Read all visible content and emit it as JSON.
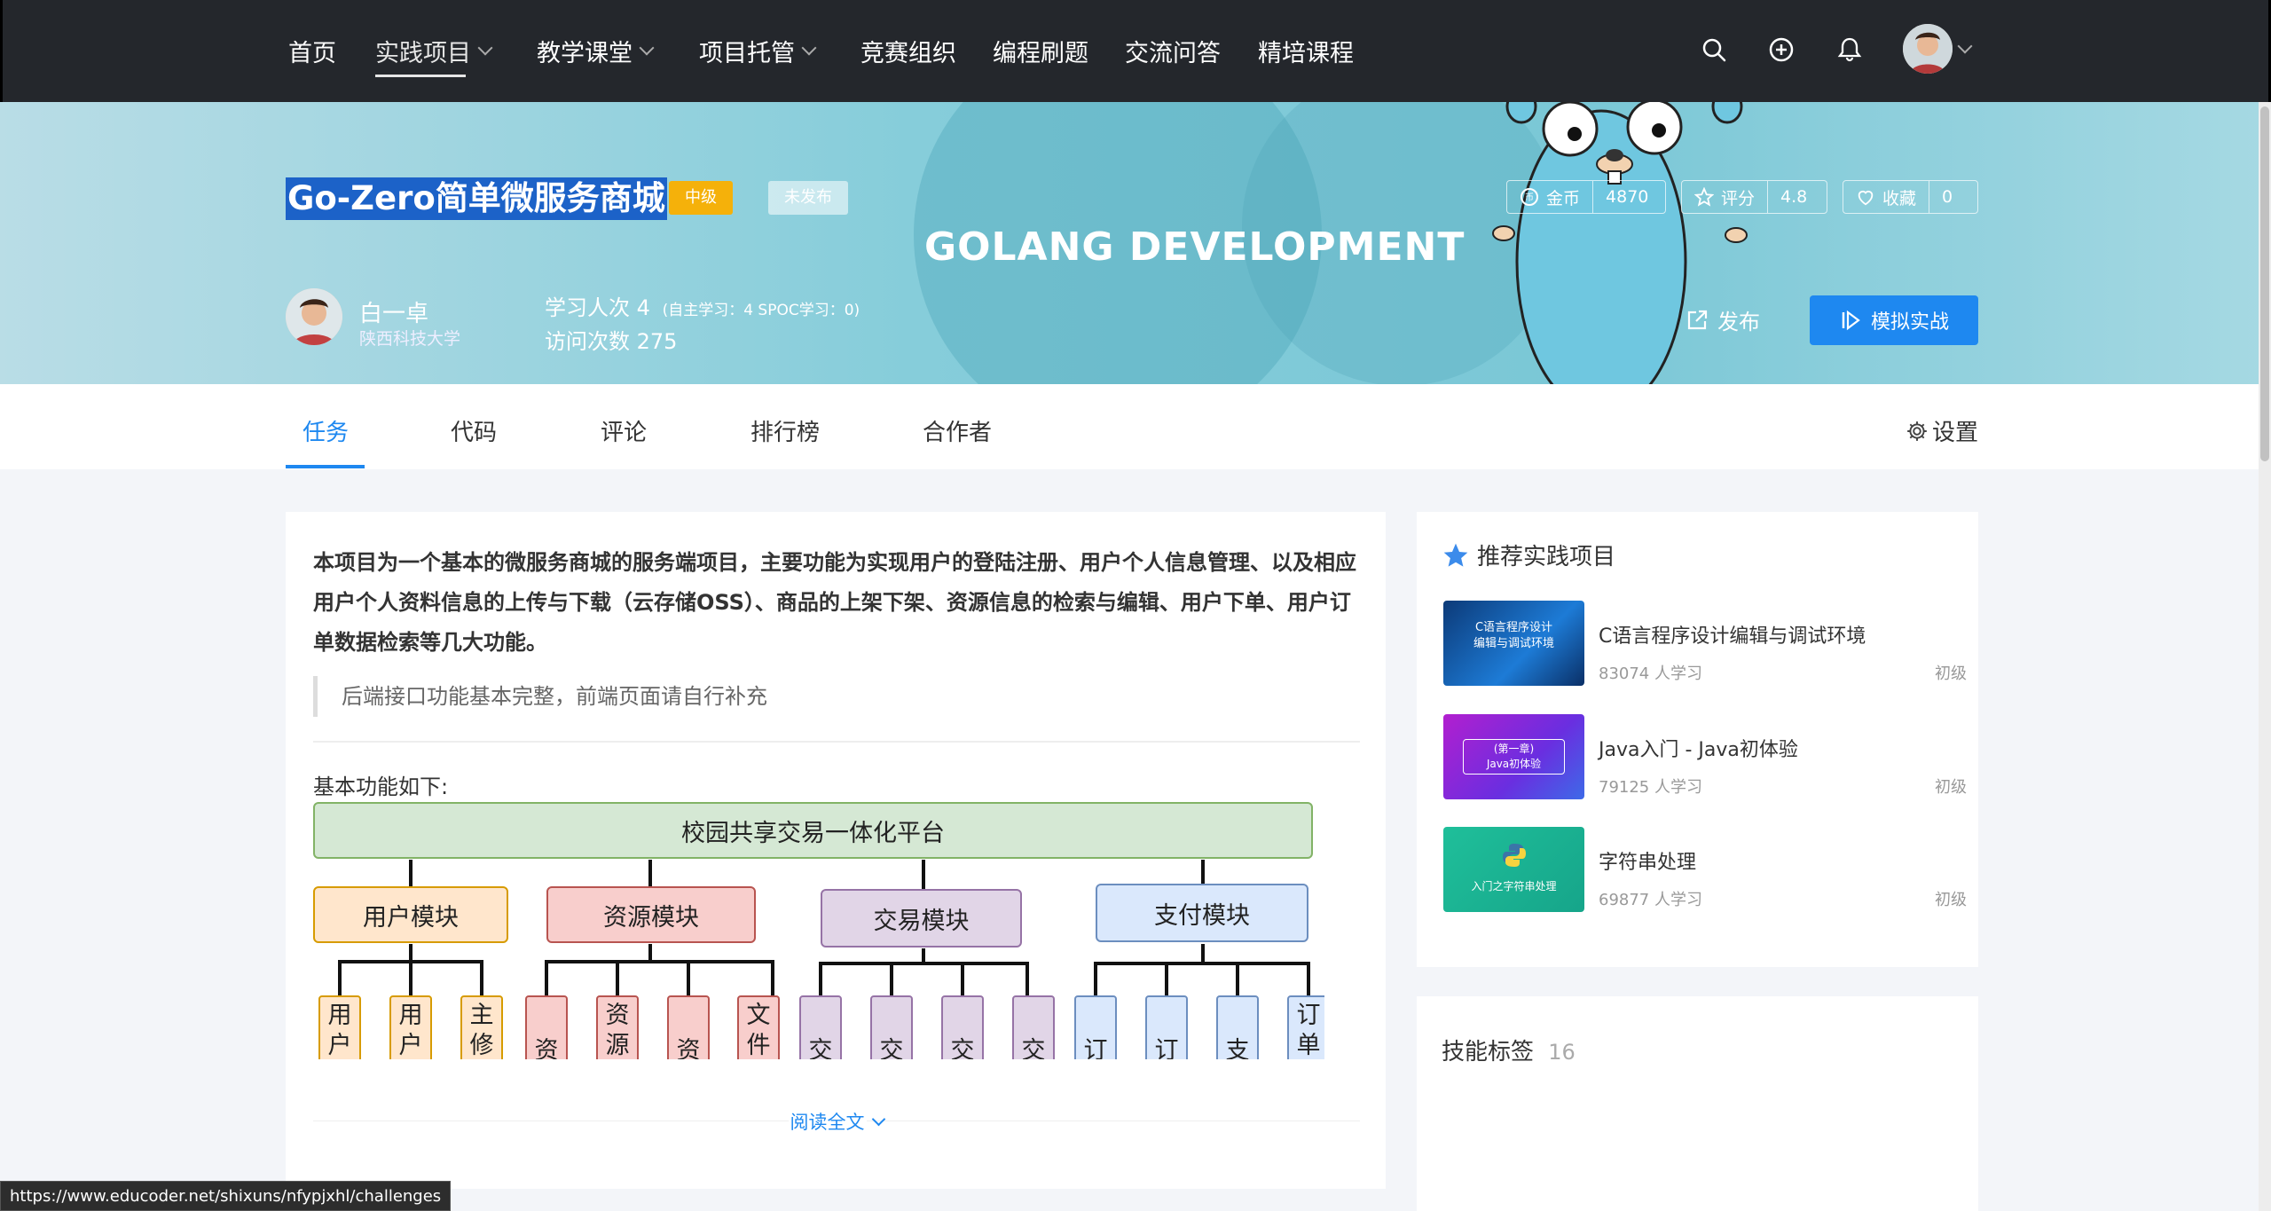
{
  "nav": {
    "items": [
      {
        "label": "首页",
        "has_dropdown": false
      },
      {
        "label": "实践项目",
        "has_dropdown": true,
        "active": true
      },
      {
        "label": "教学课堂",
        "has_dropdown": true
      },
      {
        "label": "项目托管",
        "has_dropdown": true
      },
      {
        "label": "竞赛组织",
        "has_dropdown": false
      },
      {
        "label": "编程刷题",
        "has_dropdown": false
      },
      {
        "label": "交流问答",
        "has_dropdown": false
      },
      {
        "label": "精培课程",
        "has_dropdown": false
      }
    ],
    "icons": [
      "search-icon",
      "plus-circle-icon",
      "bell-icon",
      "user-avatar"
    ]
  },
  "banner": {
    "title": "Go-Zero简单微服务商城",
    "level_badge": "中级",
    "status_badge": "未发布",
    "watermark": "GOLANG DEVELOPMENT",
    "author_name": "白一卓",
    "author_school": "陕西科技大学",
    "learners_label": "学习人次",
    "learners_value": "4",
    "learners_detail": "(自主学习：4   SPOC学习：0)",
    "visits_label": "访问次数",
    "visits_value": "275",
    "stats": {
      "coins_label": "金币",
      "coins_value": "4870",
      "rating_label": "评分",
      "rating_value": "4.8",
      "favorite_label": "收藏",
      "favorite_value": "0"
    },
    "publish_label": "发布",
    "simulate_label": "模拟实战"
  },
  "tabs": {
    "items": [
      "任务",
      "代码",
      "评论",
      "排行榜",
      "合作者"
    ],
    "settings_label": "设置"
  },
  "main": {
    "description": "本项目为一个基本的微服务商城的服务端项目，主要功能为实现用户的登陆注册、用户个人信息管理、以及相应用户个人资料信息的上传与下载（云存储OSS）、商品的上架下架、资源信息的检索与编辑、用户下单、用户订单数据检索等几大功能。",
    "quote": "后端接口功能基本完整，前端页面请自行补充",
    "features_heading": "基本功能如下:",
    "diagram": {
      "root": "校园共享交易一体化平台",
      "modules": [
        "用户模块",
        "资源模块",
        "交易模块",
        "支付模块"
      ],
      "leaves": [
        [
          "用户",
          "用户",
          "主修"
        ],
        [
          "资",
          "资源",
          "资",
          "文件"
        ],
        [
          "交",
          "交",
          "交",
          "交"
        ],
        [
          "订",
          "订",
          "支",
          "订单"
        ]
      ]
    },
    "read_more": "阅读全文"
  },
  "sidebar": {
    "recommend_title": "推荐实践项目",
    "recommend_items": [
      {
        "name": "C语言程序设计编辑与调试环境",
        "count": "83074 人学习",
        "level": "初级",
        "thumb_text": "C语言程序设计\n编辑与调试环境"
      },
      {
        "name": "Java入门 - Java初体验",
        "count": "79125 人学习",
        "level": "初级",
        "thumb_text": "(第一章)\nJava初体验"
      },
      {
        "name": "字符串处理",
        "count": "69877 人学习",
        "level": "初级",
        "thumb_text": "入门之字符串处理"
      }
    ],
    "skills_title": "技能标签",
    "skills_count": "16"
  },
  "status_bar": {
    "url": "https://www.educoder.net/shixuns/nfypjxhl/challenges"
  },
  "colors": {
    "accent": "#1e88f0",
    "nav_bg": "#24272c",
    "level_badge": "#f5b10a",
    "title_highlight": "#1c62c8"
  }
}
